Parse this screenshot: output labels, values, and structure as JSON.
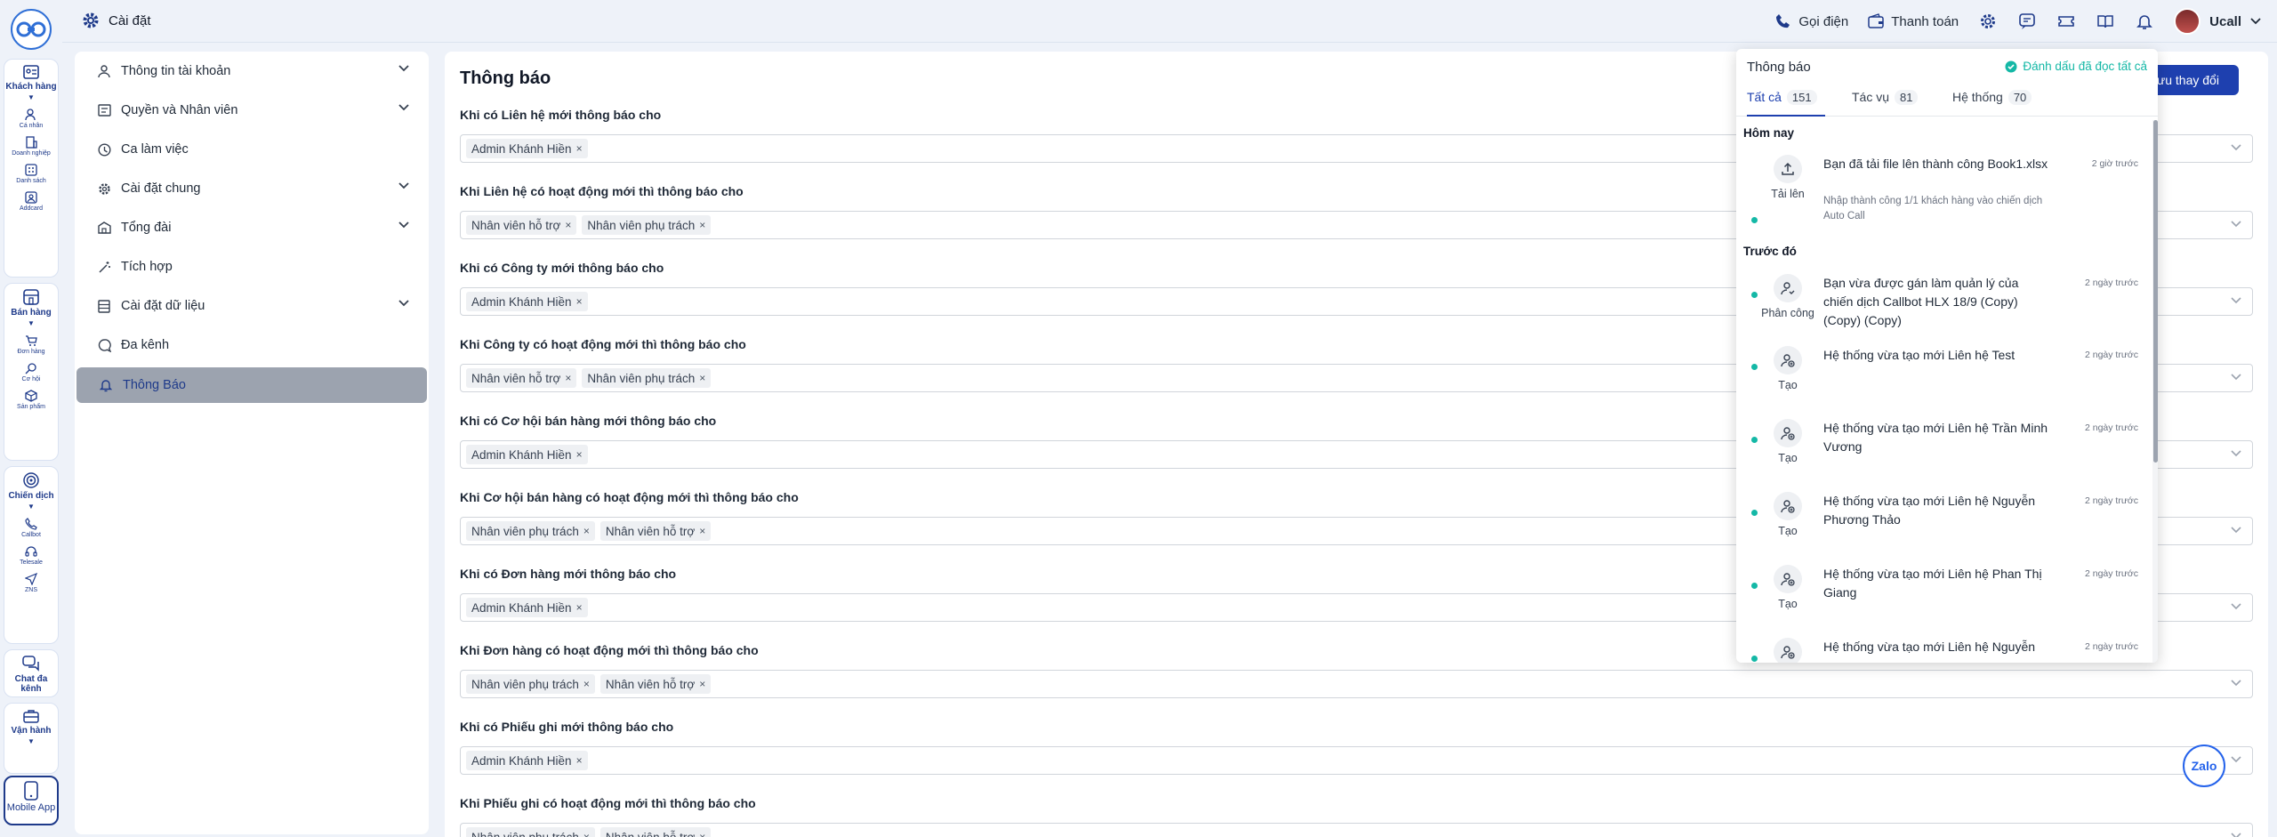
{
  "rail": {
    "groups": [
      {
        "title": "Khách hàng",
        "items": [
          "Cá nhân",
          "Doanh nghiệp",
          "Danh sách",
          "Addcard"
        ]
      },
      {
        "title": "Bán hàng",
        "items": [
          "Đơn hàng",
          "Cơ hội",
          "Sản phẩm"
        ]
      },
      {
        "title": "Chiến dịch",
        "items": [
          "Callbot",
          "Telesale",
          "ZNS"
        ]
      },
      {
        "title": "Chat đa kênh"
      },
      {
        "title": "Vận hành"
      },
      {
        "title": "Mobile App"
      }
    ]
  },
  "topbar": {
    "title": "Cài đặt",
    "call_label": "Gọi điện",
    "payment_label": "Thanh toán",
    "user_name": "Ucall"
  },
  "sidebar": {
    "items": [
      {
        "label": "Thông tin tài khoản",
        "icon": "user-icon",
        "expandable": true
      },
      {
        "label": "Quyền và Nhân viên",
        "icon": "id-card-icon",
        "expandable": true
      },
      {
        "label": "Ca làm việc",
        "icon": "clock-icon",
        "expandable": false
      },
      {
        "label": "Cài đặt chung",
        "icon": "gear-icon",
        "expandable": true
      },
      {
        "label": "Tổng đài",
        "icon": "building-icon",
        "expandable": true
      },
      {
        "label": "Tích hợp",
        "icon": "wand-icon",
        "expandable": false
      },
      {
        "label": "Cài đặt dữ liệu",
        "icon": "database-icon",
        "expandable": true
      },
      {
        "label": "Đa kênh",
        "icon": "chat-icon",
        "expandable": false
      },
      {
        "label": "Thông Báo",
        "icon": "bell-icon",
        "expandable": false,
        "active": true
      }
    ]
  },
  "main": {
    "title": "Thông báo",
    "save_label": "Lưu thay đổi",
    "rows": [
      {
        "label": "Khi có Liên hệ mới thông báo cho",
        "tags": [
          "Admin Khánh Hiền"
        ]
      },
      {
        "label": "Khi Liên hệ có hoạt động mới thì thông báo cho",
        "tags": [
          "Nhân viên hỗ trợ",
          "Nhân viên phụ trách"
        ]
      },
      {
        "label": "Khi có Công ty mới thông báo cho",
        "tags": [
          "Admin Khánh Hiền"
        ]
      },
      {
        "label": "Khi Công ty có hoạt động mới thì thông báo cho",
        "tags": [
          "Nhân viên hỗ trợ",
          "Nhân viên phụ trách"
        ]
      },
      {
        "label": "Khi có Cơ hội bán hàng mới thông báo cho",
        "tags": [
          "Admin Khánh Hiền"
        ]
      },
      {
        "label": "Khi Cơ hội bán hàng có hoạt động mới thì thông báo cho",
        "tags": [
          "Nhân viên phụ trách",
          "Nhân viên hỗ trợ"
        ]
      },
      {
        "label": "Khi có Đơn hàng mới thông báo cho",
        "tags": [
          "Admin Khánh Hiền"
        ]
      },
      {
        "label": "Khi Đơn hàng có hoạt động mới thì thông báo cho",
        "tags": [
          "Nhân viên phụ trách",
          "Nhân viên hỗ trợ"
        ]
      },
      {
        "label": "Khi có Phiếu ghi mới thông báo cho",
        "tags": [
          "Admin Khánh Hiền"
        ]
      },
      {
        "label": "Khi Phiếu ghi có hoạt động mới thì thông báo cho",
        "tags": [
          "Nhân viên phụ trách",
          "Nhân viên hỗ trợ"
        ]
      }
    ]
  },
  "notifications": {
    "title": "Thông báo",
    "mark_all": "Đánh dấu đã đọc tất cả",
    "tabs": [
      {
        "label": "Tất cả",
        "count": "151",
        "active": true
      },
      {
        "label": "Tác vụ",
        "count": "81"
      },
      {
        "label": "Hệ thống",
        "count": "70"
      }
    ],
    "today_label": "Hôm nay",
    "earlier_label": "Trước đó",
    "today": [
      {
        "icon": "upload-icon",
        "type": "Tải lên",
        "text": "Bạn đã tải file lên thành công Book1.xlsx",
        "sub": "Nhập thành công 1/1 khách hàng vào chiến dịch Auto Call",
        "time": "2 giờ trước"
      }
    ],
    "earlier": [
      {
        "icon": "user-assign-icon",
        "type": "Phân công",
        "text": "Bạn vừa được gán làm quản lý của chiến dịch Callbot HLX 18/9 (Copy) (Copy) (Copy)",
        "time": "2 ngày trước"
      },
      {
        "icon": "user-add-icon",
        "type": "Tạo",
        "text": "Hệ thống vừa tạo mới Liên hệ Test",
        "time": "2 ngày trước"
      },
      {
        "icon": "user-add-icon",
        "type": "Tạo",
        "text": "Hệ thống vừa tạo mới Liên hệ Trần Minh Vương",
        "time": "2 ngày trước"
      },
      {
        "icon": "user-add-icon",
        "type": "Tạo",
        "text": "Hệ thống vừa tạo mới Liên hệ Nguyễn Phương Thảo",
        "time": "2 ngày trước"
      },
      {
        "icon": "user-add-icon",
        "type": "Tạo",
        "text": "Hệ thống vừa tạo mới Liên hệ Phan Thị Giang",
        "time": "2 ngày trước"
      },
      {
        "icon": "user-add-icon",
        "type": "Tạo",
        "text": "Hệ thống vừa tạo mới Liên hệ Nguyễn",
        "time": "2 ngày trước"
      }
    ]
  },
  "zalo_label": "Zalo",
  "colors": {
    "accent": "#1e40af",
    "teal": "#14b8a6",
    "active_bg": "#9ca3af"
  }
}
